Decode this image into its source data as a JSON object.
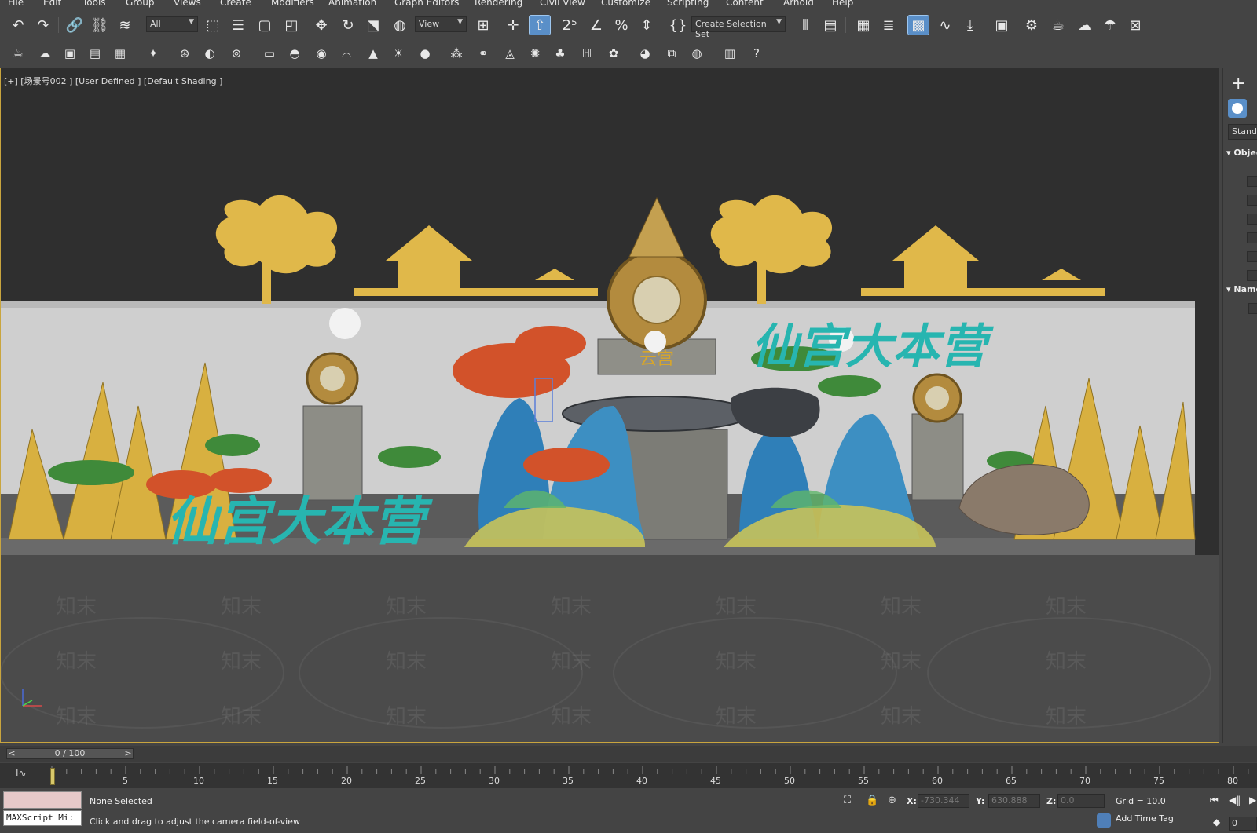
{
  "menu": [
    "File",
    "Edit",
    "Tools",
    "Group",
    "Views",
    "Create",
    "Modifiers",
    "Animation",
    "Graph Editors",
    "Rendering",
    "Civil View",
    "Customize",
    "Scripting",
    "Content",
    "Arnold",
    "Help"
  ],
  "toolbar": {
    "selection_filter": "All",
    "ref_coord": "View",
    "selection_set": "Create Selection Set"
  },
  "viewport": {
    "label": "[+] [场景号002 ] [User Defined ] [Default Shading ]",
    "scene_text_front": "仙宫大本营",
    "scene_text_back": "仙宫大本营",
    "scene_sign": "云宫",
    "watermark": "知末"
  },
  "command_panel": {
    "standard_label": "Standard",
    "rollout_object": "Object Type",
    "rollout_name": "Name and Color"
  },
  "time_slider": {
    "position_label": "0 / 100",
    "prev": "<",
    "next": ">"
  },
  "track_bar": {
    "ticks": [
      "5",
      "10",
      "15",
      "20",
      "25",
      "30",
      "35",
      "40",
      "45",
      "50",
      "55",
      "60",
      "65",
      "70",
      "75",
      "80"
    ]
  },
  "status": {
    "maxscript_label": "MAXScript Mi:",
    "selection": "None Selected",
    "prompt": "Click and drag to adjust the camera field-of-view",
    "x_label": "X:",
    "x_value": "-730.344",
    "y_label": "Y:",
    "y_value": "630.888",
    "z_label": "Z:",
    "z_value": "0.0",
    "grid": "Grid = 10.0",
    "add_time_tag": "Add Time Tag",
    "frame": "0"
  }
}
